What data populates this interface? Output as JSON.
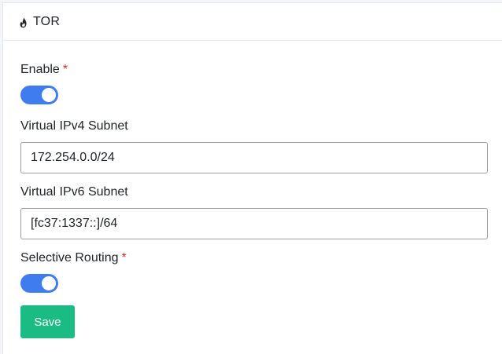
{
  "card": {
    "title": "TOR",
    "icon": "flame-icon"
  },
  "form": {
    "enable": {
      "label": "Enable",
      "required_mark": "*",
      "value": true
    },
    "ipv4_subnet": {
      "label": "Virtual IPv4 Subnet",
      "value": "172.254.0.0/24"
    },
    "ipv6_subnet": {
      "label": "Virtual IPv6 Subnet",
      "value": "[fc37:1337::]/64"
    },
    "selective_routing": {
      "label": "Selective Routing",
      "required_mark": "*",
      "value": true
    },
    "save_label": "Save"
  },
  "colors": {
    "accent": "#3e7cf0",
    "save": "#1bbc84",
    "required": "#e02424"
  }
}
